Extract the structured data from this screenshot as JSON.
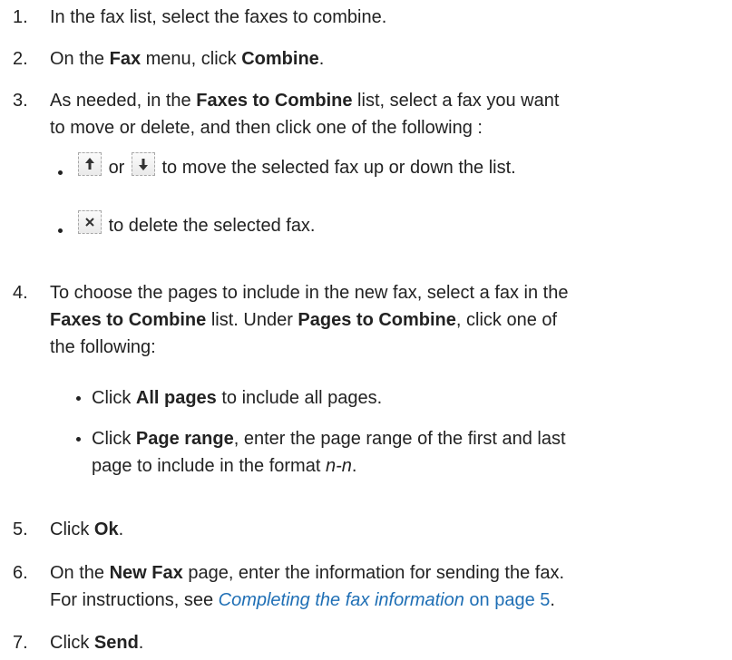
{
  "steps": [
    {
      "num": "1.",
      "text": "In the fax list, select the faxes to combine."
    },
    {
      "num": "2.",
      "pre": "On the ",
      "b1": "Fax",
      "mid": " menu, click ",
      "b2": "Combine",
      "post": "."
    },
    {
      "num": "3.",
      "pre": "As needed, in the ",
      "b1": "Faxes to Combine",
      "post1": " list, select a fax you want",
      "line2": "to move or delete, and then click one of the following :"
    },
    {
      "num": "4.",
      "line1": "To choose the pages to include in the new fax, select a fax in the",
      "b1": "Faxes to Combine",
      "mid": " list. Under ",
      "b2": "Pages to Combine",
      "post": ", click one of",
      "line3": "the following:"
    },
    {
      "num": "5.",
      "pre": "Click ",
      "b1": "Ok",
      "post": "."
    },
    {
      "num": "6.",
      "pre": "On the ",
      "b1": "New Fax",
      "post1": " page, enter the information for sending the fax.",
      "line2pre": "For instructions, see ",
      "link": "Completing the fax information",
      "linkpage": " on page 5",
      "line2post": "."
    },
    {
      "num": "7.",
      "pre": "Click ",
      "b1": "Send",
      "post": "."
    }
  ],
  "step3_bullets": {
    "move_or": "or",
    "move_text": "to move the selected fax up or down the list.",
    "delete_text": "to delete the selected fax."
  },
  "step4_bullets": {
    "all_pre": "Click ",
    "all_b": "All pages",
    "all_post": " to include all pages.",
    "range_pre": "Click ",
    "range_b": "Page range",
    "range_post": ", enter the page range of the first and last",
    "range_line2_pre": "page to include in the format ",
    "range_line2_i": "n-n",
    "range_line2_post": "."
  },
  "icons": {
    "move_up": "arrow-up-icon",
    "move_down": "arrow-down-icon",
    "delete": "close-icon"
  },
  "colors": {
    "text": "#222222",
    "link": "#1f6fb5"
  }
}
